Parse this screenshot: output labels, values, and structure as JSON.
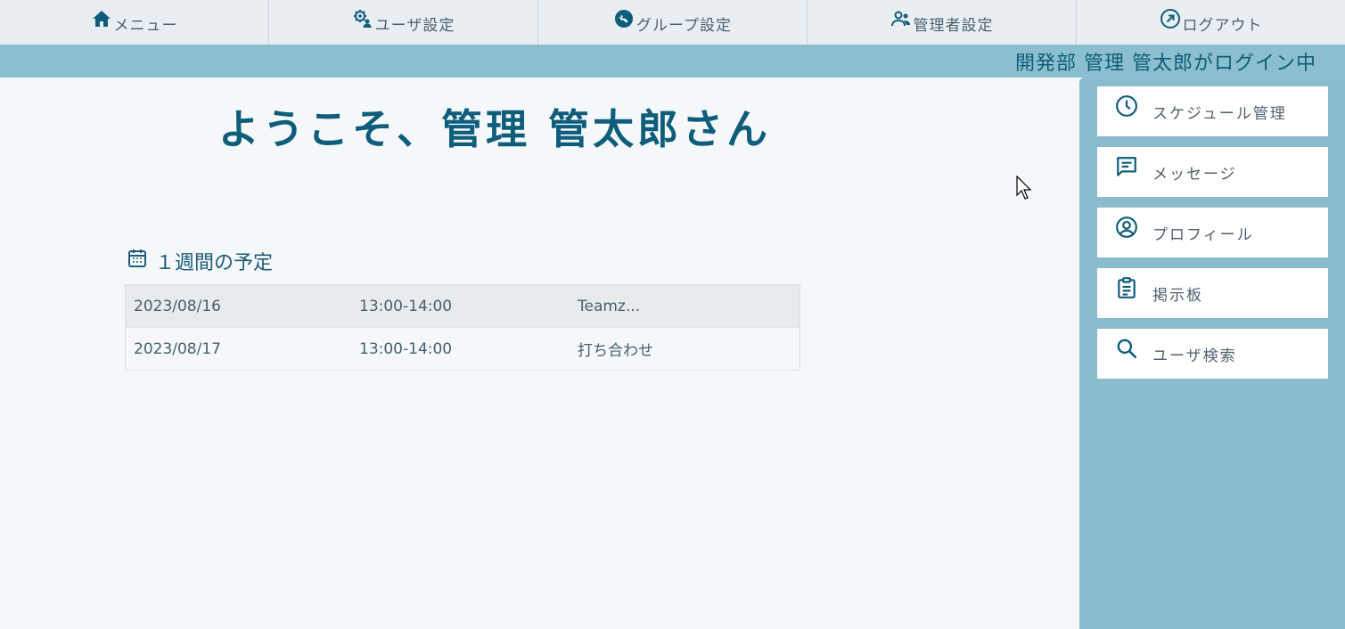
{
  "nav": {
    "items": [
      {
        "label": "メニュー",
        "icon": "home-icon"
      },
      {
        "label": "ユーザ設定",
        "icon": "user-gear-icon"
      },
      {
        "label": "グループ設定",
        "icon": "wrench-icon"
      },
      {
        "label": "管理者設定",
        "icon": "admin-users-icon"
      },
      {
        "label": "ログアウト",
        "icon": "logout-arrow-icon"
      }
    ]
  },
  "status": {
    "login_text": "開発部 管理 管太郎がログイン中"
  },
  "main": {
    "welcome": "ようこそ、管理 管太郎さん",
    "schedule_title": "１週間の予定",
    "schedule_rows": [
      {
        "date": "2023/08/16",
        "time": "13:00-14:00",
        "title": "Teamz..."
      },
      {
        "date": "2023/08/17",
        "time": "13:00-14:00",
        "title": "打ち合わせ"
      }
    ]
  },
  "sidebar": {
    "items": [
      {
        "label": "スケジュール管理",
        "icon": "clock-icon"
      },
      {
        "label": "メッセージ",
        "icon": "message-icon"
      },
      {
        "label": "プロフィール",
        "icon": "profile-icon"
      },
      {
        "label": "掲示板",
        "icon": "clipboard-icon"
      },
      {
        "label": "ユーザ検索",
        "icon": "search-icon"
      }
    ]
  },
  "colors": {
    "primary": "#0e5d7b",
    "status_bar": "#8bbfcf",
    "sidebar": "#8bbcce",
    "nav_bg": "#e9eef3"
  }
}
